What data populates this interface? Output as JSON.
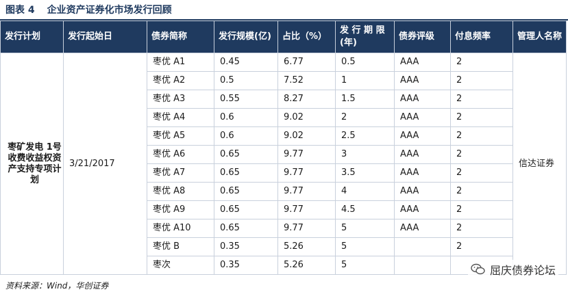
{
  "figure": {
    "label": "图表 4",
    "title": "企业资产证券化市场发行回顾"
  },
  "table": {
    "headers": [
      "发行计划",
      "发行起始日",
      "债券简称",
      "发行规模(亿)",
      "占比（%）",
      "发 行 期 限 (年)",
      "债券评级",
      "付息频率",
      "管理人名称"
    ],
    "plan_name": "枣矿发电 1号收费收益权资产支持专项计划",
    "start_date": "3/21/2017",
    "manager": "信达证券",
    "rows": [
      [
        "枣优 A1",
        "0.45",
        "6.77",
        "0.5",
        "AAA",
        "2"
      ],
      [
        "枣优 A2",
        "0.5",
        "7.52",
        "1",
        "AAA",
        "2"
      ],
      [
        "枣优 A3",
        "0.55",
        "8.27",
        "1.5",
        "AAA",
        "2"
      ],
      [
        "枣优 A4",
        "0.6",
        "9.02",
        "2",
        "AAA",
        "2"
      ],
      [
        "枣优 A5",
        "0.6",
        "9.02",
        "2.5",
        "AAA",
        "2"
      ],
      [
        "枣优 A6",
        "0.65",
        "9.77",
        "3",
        "AAA",
        "2"
      ],
      [
        "枣优 A7",
        "0.65",
        "9.77",
        "3.5",
        "AAA",
        "2"
      ],
      [
        "枣优 A8",
        "0.65",
        "9.77",
        "4",
        "AAA",
        "2"
      ],
      [
        "枣优 A9",
        "0.65",
        "9.77",
        "4.5",
        "AAA",
        "2"
      ],
      [
        "枣优 A10",
        "0.65",
        "9.77",
        "5",
        "AAA",
        "2"
      ],
      [
        "枣优 B",
        "0.35",
        "5.26",
        "5",
        "",
        "2"
      ],
      [
        "枣次",
        "0.35",
        "5.26",
        "5",
        "",
        ""
      ]
    ]
  },
  "footer": {
    "source": "资料来源：Wind，华创证券"
  },
  "watermark": {
    "text": "屈庆债券论坛",
    "icon": "wechat-icon"
  },
  "colors": {
    "header_bg": "#1f3a5f",
    "border": "#c8d0dc"
  }
}
